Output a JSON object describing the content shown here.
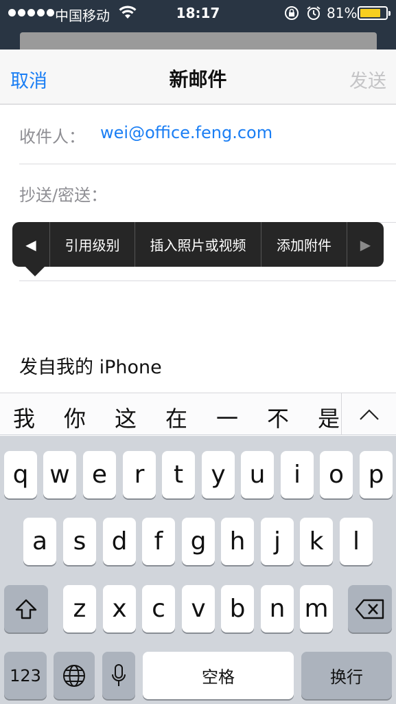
{
  "status_bar": {
    "carrier": "中国移动",
    "time": "18:17",
    "battery_percent": "81%",
    "battery_level": 0.81,
    "icons": [
      "signal-dots-icon",
      "wifi-icon",
      "orientation-lock-icon",
      "alarm-icon",
      "battery-icon"
    ]
  },
  "nav": {
    "cancel": "取消",
    "title": "新邮件",
    "send": "发送"
  },
  "fields": {
    "to_label": "收件人：",
    "to_value": "wei@office.feng.com",
    "cc_label": "抄送/密送："
  },
  "edit_menu": {
    "items": [
      "引用级别",
      "插入照片或视频",
      "添加附件"
    ]
  },
  "body": {
    "signature": "发自我的 iPhone"
  },
  "candidates": [
    "我",
    "你",
    "这",
    "在",
    "一",
    "不",
    "是"
  ],
  "keyboard": {
    "row1": [
      "q",
      "w",
      "e",
      "r",
      "t",
      "y",
      "u",
      "i",
      "o",
      "p"
    ],
    "row2": [
      "a",
      "s",
      "d",
      "f",
      "g",
      "h",
      "j",
      "k",
      "l"
    ],
    "row3": [
      "z",
      "x",
      "c",
      "v",
      "b",
      "n",
      "m"
    ],
    "numbers": "123",
    "space": "空格",
    "return": "换行"
  },
  "colors": {
    "accent": "#1a7ef4",
    "status_bg": "#293543",
    "battery": "#f7cf1f",
    "keyboard_bg": "#d1d5db"
  }
}
